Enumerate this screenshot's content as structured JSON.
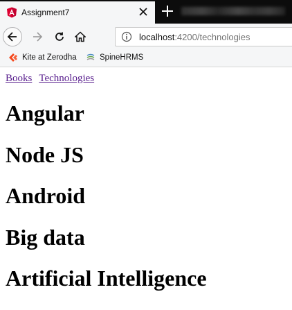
{
  "browser": {
    "tab": {
      "title": "Assignment7"
    },
    "url": {
      "host": "localhost",
      "path": ":4200/technologies"
    },
    "bookmarks": [
      {
        "label": "Kite at Zerodha"
      },
      {
        "label": "SpineHRMS"
      }
    ]
  },
  "page": {
    "nav_links": [
      {
        "label": "Books"
      },
      {
        "label": "Technologies"
      }
    ],
    "technologies": [
      {
        "name": "Angular"
      },
      {
        "name": "Node JS"
      },
      {
        "name": "Android"
      },
      {
        "name": "Big data"
      },
      {
        "name": "Artificial Intelligence"
      }
    ]
  },
  "colors": {
    "link_visited": "#551a8b",
    "angular_red": "#dd0031"
  }
}
